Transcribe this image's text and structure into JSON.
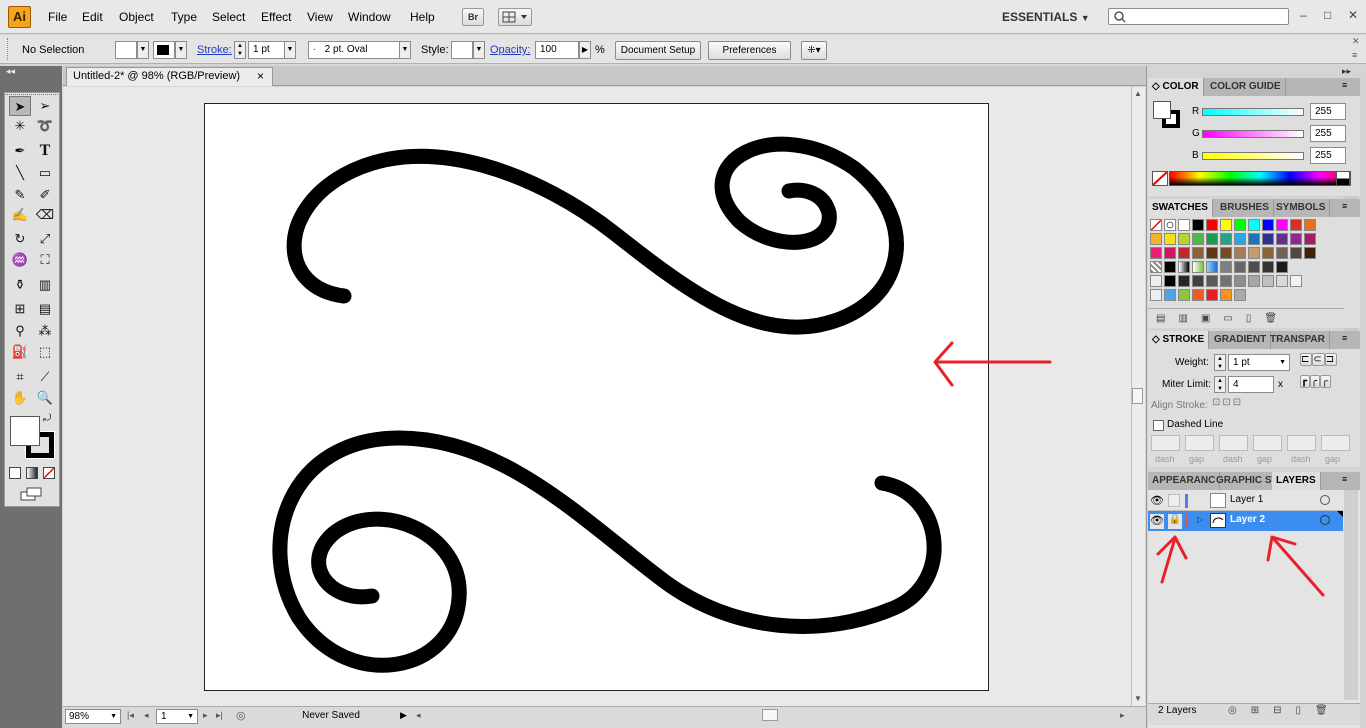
{
  "app": {
    "logo": "Ai"
  },
  "menu": [
    "File",
    "Edit",
    "Object",
    "Type",
    "Select",
    "Effect",
    "View",
    "Window",
    "Help"
  ],
  "workspace": {
    "label": "ESSENTIALS"
  },
  "control_bar": {
    "selection_label": "No Selection",
    "stroke_label": "Stroke:",
    "stroke_weight": "1 pt",
    "brush_def": "2 pt. Oval",
    "style_label": "Style:",
    "opacity_label": "Opacity:",
    "opacity_value": "100",
    "percent": "%",
    "document_setup": "Document Setup",
    "preferences": "Preferences"
  },
  "document": {
    "tab_title": "Untitled-2* @ 98% (RGB/Preview)",
    "close": "×"
  },
  "status_bar": {
    "zoom": "98%",
    "artboard": "1",
    "status": "Never Saved"
  },
  "color_panel": {
    "tabs": [
      "COLOR",
      "COLOR GUIDE"
    ],
    "channels": [
      {
        "label": "R",
        "value": "255",
        "color": "#00c8e0"
      },
      {
        "label": "G",
        "value": "255",
        "color": "#e000c8"
      },
      {
        "label": "B",
        "value": "255",
        "color": "#e8e000"
      }
    ]
  },
  "swatches_panel": {
    "tabs": [
      "SWATCHES",
      "BRUSHES",
      "SYMBOLS"
    ]
  },
  "stroke_panel": {
    "tabs": [
      "STROKE",
      "GRADIENT",
      "TRANSPAR"
    ],
    "weight_label": "Weight:",
    "weight_value": "1 pt",
    "miter_label": "Miter Limit:",
    "miter_value": "4",
    "miter_unit": "x",
    "align_label": "Align Stroke:",
    "dashed_label": "Dashed Line",
    "dash_labels": [
      "dash",
      "gap",
      "dash",
      "gap",
      "dash",
      "gap"
    ]
  },
  "layers_panel": {
    "tabs": [
      "APPEARANC",
      "GRAPHIC ST",
      "LAYERS"
    ],
    "layers": [
      {
        "name": "Layer 1",
        "color": "#4f7fe8",
        "selected": false,
        "locked": false
      },
      {
        "name": "Layer 2",
        "color": "#e84f4f",
        "selected": true,
        "locked": true
      }
    ],
    "footer": "2 Layers"
  },
  "colors": {
    "selection_blue": "#3b8df0",
    "annotation_red": "#e8202a"
  }
}
